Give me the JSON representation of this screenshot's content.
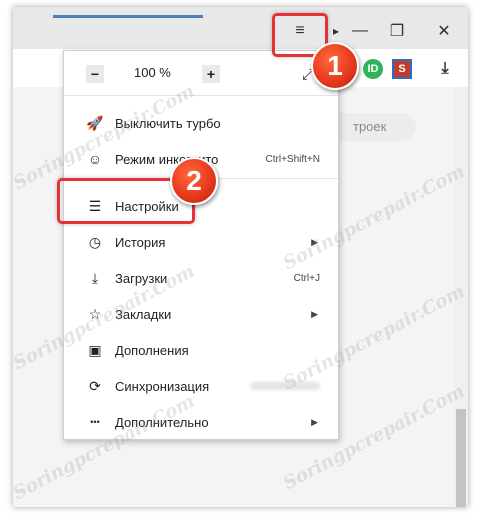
{
  "toolbar": {
    "menu_icon": "hamburger-icon",
    "minimize": "—",
    "restore": "❐",
    "close": "✕",
    "extensions": [
      {
        "name": "pause-ext-icon",
        "letter": "ID",
        "color": "#2fb45a"
      },
      {
        "name": "s-ext-icon",
        "letter": "S",
        "color": "#c23a2b"
      },
      {
        "name": "download-icon",
        "letter": "⤓",
        "color": "#333333"
      }
    ]
  },
  "zoom": {
    "minus": "−",
    "value": "100 %",
    "plus": "+"
  },
  "search_placeholder": "троек",
  "menu": {
    "items": [
      {
        "name": "turbo",
        "icon": "rocket-icon",
        "glyph": "🚀",
        "label": "Выключить турбо",
        "shortcut": "",
        "arrow": false
      },
      {
        "name": "incognito",
        "icon": "mask-icon",
        "glyph": "☺",
        "label": "Режим инкогнито",
        "shortcut": "Ctrl+Shift+N",
        "arrow": false
      },
      {
        "name": "settings",
        "icon": "sliders-icon",
        "glyph": "☰",
        "label": "Настройки",
        "shortcut": "",
        "arrow": false
      },
      {
        "name": "history",
        "icon": "clock-icon",
        "glyph": "◷",
        "label": "История",
        "shortcut": "",
        "arrow": true
      },
      {
        "name": "downloads",
        "icon": "download-icon",
        "glyph": "⤓",
        "label": "Загрузки",
        "shortcut": "Ctrl+J",
        "arrow": false
      },
      {
        "name": "bookmarks",
        "icon": "star-icon",
        "glyph": "☆",
        "label": "Закладки",
        "shortcut": "",
        "arrow": true
      },
      {
        "name": "addons",
        "icon": "addons-icon",
        "glyph": "▣",
        "label": "Дополнения",
        "shortcut": "",
        "arrow": false
      },
      {
        "name": "sync",
        "icon": "sync-icon",
        "glyph": "⟳",
        "label": "Синхронизация",
        "shortcut": "",
        "arrow": false,
        "blurred": true
      },
      {
        "name": "more",
        "icon": "more-icon",
        "glyph": "•••",
        "label": "Дополнительно",
        "shortcut": "",
        "arrow": true
      }
    ],
    "arrow_glyph": "▶"
  },
  "annotations": {
    "step1": "1",
    "step2": "2"
  },
  "watermark": "Soringpcrepair.Com",
  "colors": {
    "highlight": "#e53238",
    "badge": "#e83a1e"
  }
}
